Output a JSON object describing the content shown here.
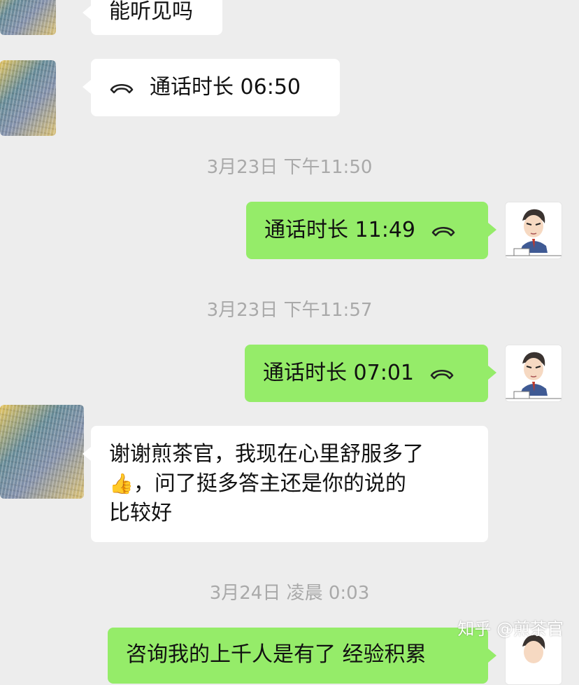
{
  "messages": [
    {
      "id": "m1",
      "side": "left",
      "type": "text",
      "text": "能听见吗"
    },
    {
      "id": "m2",
      "side": "left",
      "type": "call",
      "text": "通话时长 06:50"
    },
    {
      "id": "t1",
      "type": "timestamp",
      "text": "3月23日 下午11:50"
    },
    {
      "id": "m3",
      "side": "right",
      "type": "call",
      "text": "通话时长 11:49"
    },
    {
      "id": "t2",
      "type": "timestamp",
      "text": "3月23日 下午11:57"
    },
    {
      "id": "m4",
      "side": "right",
      "type": "call",
      "text": "通话时长 07:01"
    },
    {
      "id": "m5",
      "side": "left",
      "type": "text",
      "lines": [
        "谢谢煎茶官，我现在心里舒服多了",
        "，问了挺多答主还是你的说的",
        "比较好"
      ],
      "emoji": "👍"
    },
    {
      "id": "t3",
      "type": "timestamp",
      "text": "3月24日 凌晨 0:03"
    },
    {
      "id": "m6",
      "side": "right",
      "type": "text",
      "text": "咨询我的上千人是有了 经验积累"
    }
  ],
  "watermark": "知乎 @煎茶官",
  "colors": {
    "background": "#ededed",
    "bubble_self": "#95ec69",
    "bubble_other": "#ffffff",
    "timestamp": "#a9a9a9"
  },
  "icons": {
    "call": "phone-hangup-icon",
    "avatar_self": "cartoon-man-avatar",
    "avatar_other": "abstract-paint-avatar"
  }
}
